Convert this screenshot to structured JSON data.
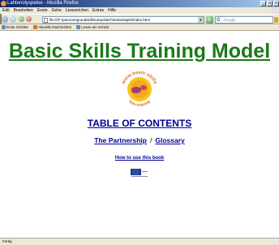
{
  "window": {
    "title": "Lahtenolyspeloe - Mozilla Firefox"
  },
  "menu": [
    "Edit",
    "Bearbeiten",
    "Exnte",
    "Gehe",
    "Lesezeichen",
    "Extras",
    "Hilfe"
  ],
  "nav": {
    "url": "file:///F:/pamrom/grundskills/umpolder/Ventaziegele/index.html",
    "search_placeholder": "Google"
  },
  "bookmarks": [
    {
      "label": "Erste Schritte"
    },
    {
      "label": "Aktuelle Nachrichten"
    },
    {
      "label": "Lesen ein Schritt"
    }
  ],
  "page": {
    "title": "Basic Skills Training Model",
    "logo_text_top": "www.basic-skills",
    "logo_text_bottom": "Edu-training",
    "toc": "TABLE OF CONTENTS",
    "partnership": "The Partnership",
    "separator": "/",
    "glossary": "Glossary",
    "howto": "How to use this book"
  },
  "status": {
    "text": "Fertig"
  },
  "colors": {
    "title_green": "#1a7a1a",
    "link_blue": "#000099",
    "logo_orange": "#f5a623",
    "logo_purple": "#8a2a8a"
  }
}
